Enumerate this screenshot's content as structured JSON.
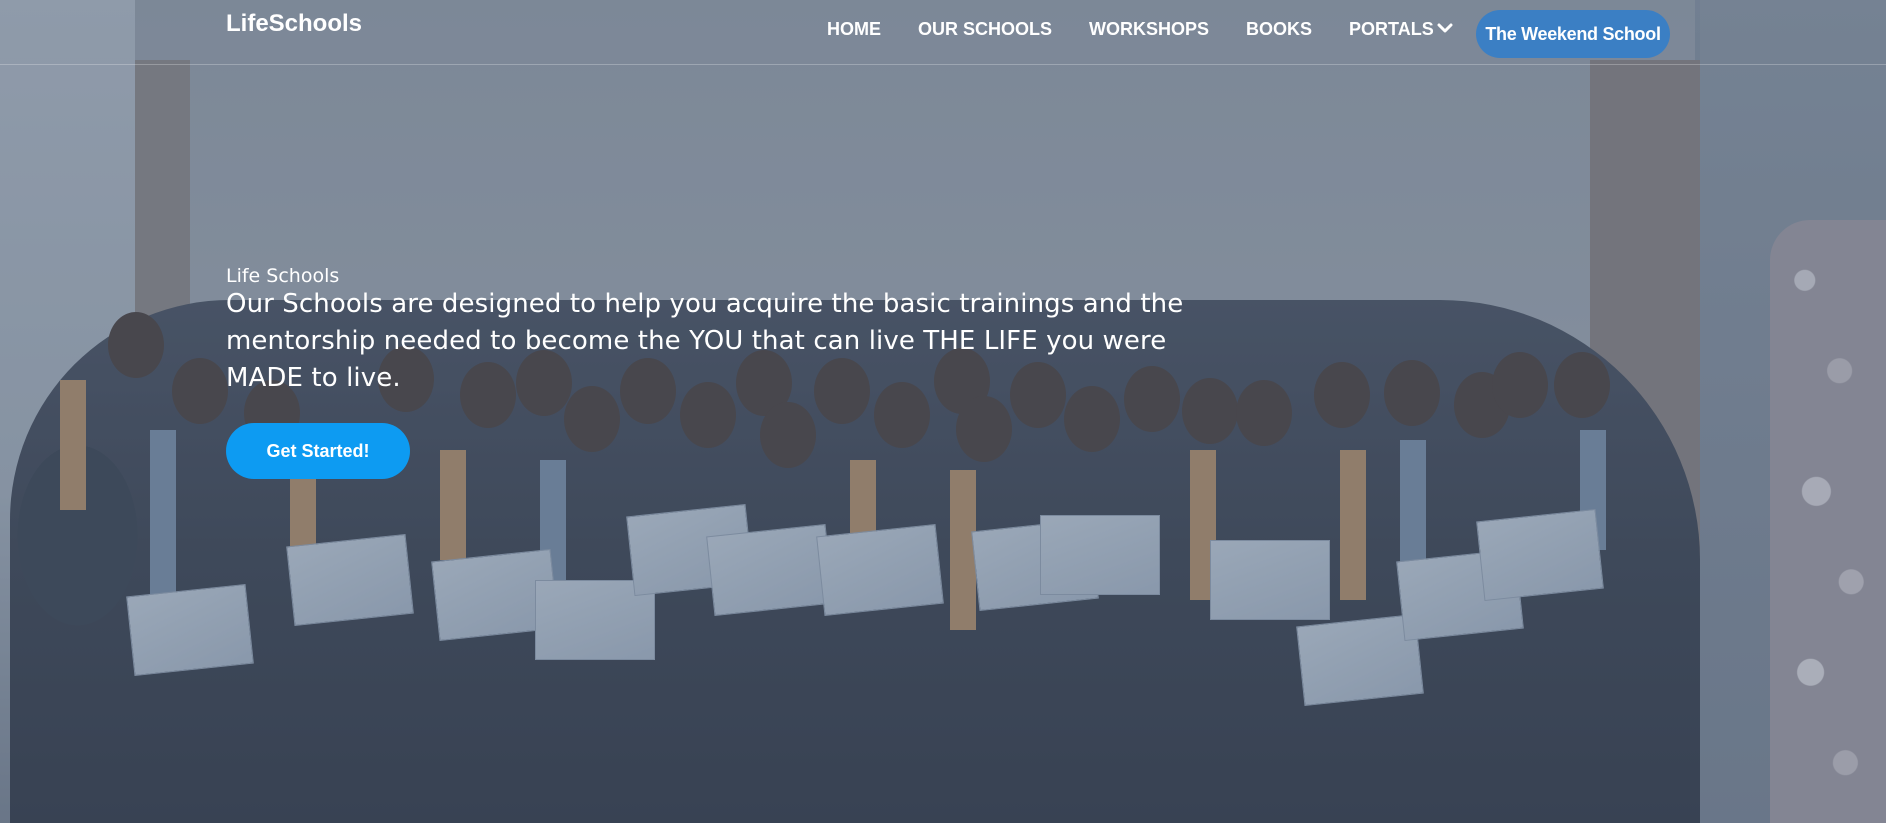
{
  "header": {
    "logo": "LifeSchools",
    "nav": [
      {
        "label": "HOME"
      },
      {
        "label": "OUR SCHOOLS"
      },
      {
        "label": "WORKSHOPS"
      },
      {
        "label": "BOOKS"
      },
      {
        "label": "PORTALS",
        "has_dropdown": true,
        "icon": "chevron-down-icon"
      }
    ],
    "cta_label": "The Weekend School"
  },
  "hero": {
    "eyebrow": "Life Schools",
    "headline": "Our Schools are designed to help you acquire the basic trainings and the mentorship needed to become the YOU that can live THE LIFE you were MADE to live.",
    "button_label": "Get Started!",
    "background_image": "group-photo"
  },
  "colors": {
    "primary_button": "#0d9bf2",
    "weekend_button": "#3b7fc4",
    "text": "#ffffff"
  }
}
